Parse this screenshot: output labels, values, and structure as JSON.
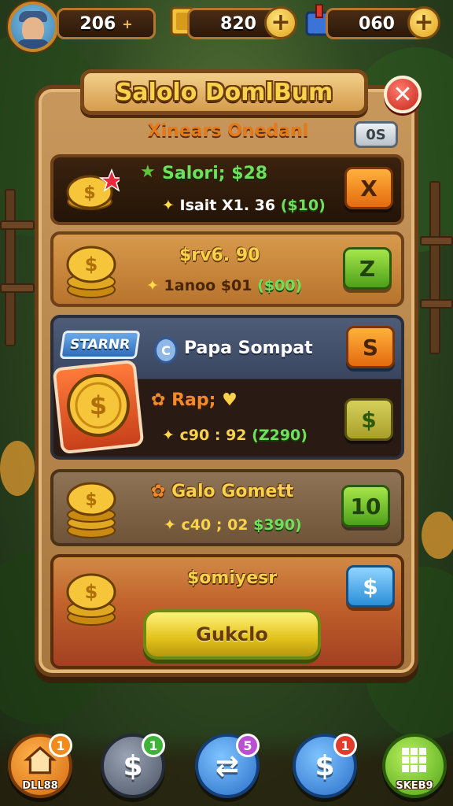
{
  "hud": {
    "coins_value": "206",
    "cash_value": "820",
    "gems_value": "060",
    "plus_label": "+"
  },
  "dialog": {
    "title": "Salolo DomlBum",
    "close_label": "✕",
    "subtitle": "Xinears Onedanl",
    "corner_badge": "0S"
  },
  "offers": [
    {
      "title": "Salori; $28",
      "price_strike": "Isait X1. 36",
      "price_green": "($10)",
      "button_label": "X"
    },
    {
      "title": "$rv6. 90",
      "price_strike": "1anoo $01",
      "price_green": "($00)",
      "button_label": "Z"
    },
    {
      "ribbon": "STARNR",
      "header": "Papa Sompat",
      "header_button_label": "S",
      "title": "Rap;",
      "price_strike": "c90 : 92",
      "price_green": "(Z290)",
      "button_label": "$"
    },
    {
      "title": "Galo Gomett",
      "price_strike": "c40 ; 02",
      "price_green": "$390)",
      "button_label": "10"
    },
    {
      "title": "$omiyesr",
      "button_label": "$",
      "cta_label": "Gukclo"
    }
  ],
  "bottom_nav": [
    {
      "label": "DLL88",
      "badge": "1",
      "icon": "home-icon",
      "badge_color": "#f28a1c"
    },
    {
      "label": "",
      "badge": "1",
      "icon": "dollar-icon",
      "badge_color": "#3fb23a"
    },
    {
      "label": "",
      "badge": "5",
      "icon": "swap-icon",
      "badge_color": "#b94fd1"
    },
    {
      "label": "",
      "badge": "1",
      "icon": "tag-icon",
      "badge_color": "#e23b2b"
    },
    {
      "label": "SKEB9",
      "icon": "grid-icon"
    }
  ],
  "colors": {
    "panel": "#b8874b",
    "accent_gold": "#f7d24a",
    "price_green": "#6ee05a"
  }
}
